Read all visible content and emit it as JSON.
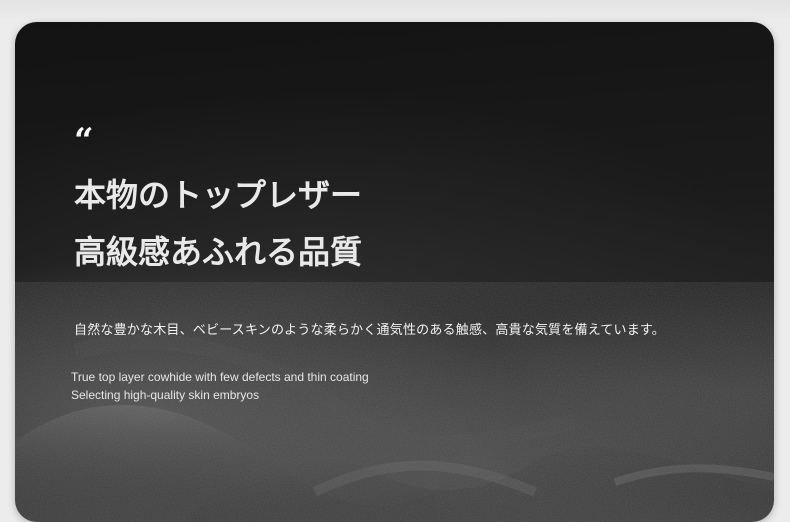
{
  "hero": {
    "quote_mark": "“",
    "headline_line1": "本物のトップレザー",
    "headline_line2": "高級感あふれる品質",
    "description_ja": "自然な豊かな木目、ベビースキンのような柔らかく通気性のある触感、高貴な気質を備えています。",
    "description_en_line1": "True top layer cowhide with few defects and thin coating",
    "description_en_line2": "Selecting high-quality skin embryos"
  },
  "colors": {
    "page_background": "#ececec",
    "card_background": "#1b1b1b",
    "headline_text": "#e9e9e9",
    "body_text": "#f2f2f2"
  }
}
